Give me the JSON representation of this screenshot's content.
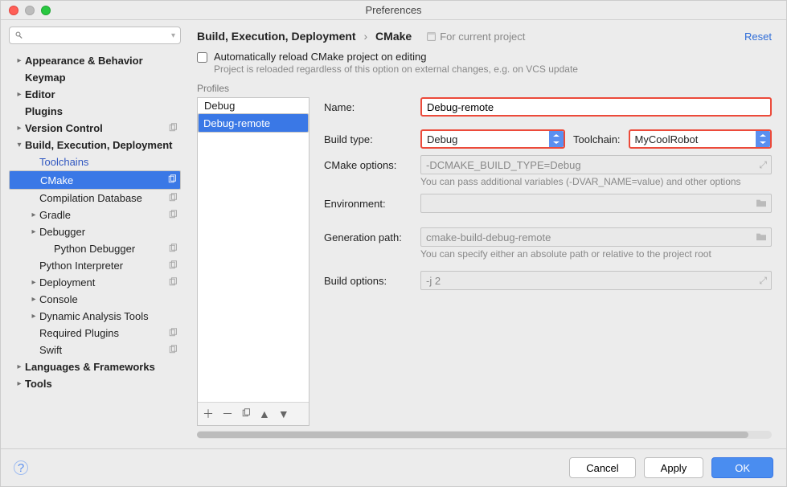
{
  "window": {
    "title": "Preferences"
  },
  "search": {
    "placeholder": ""
  },
  "sidebar": {
    "items": [
      {
        "label": "Appearance & Behavior",
        "bold": true,
        "depth": 1,
        "arrow": "▸"
      },
      {
        "label": "Keymap",
        "bold": true,
        "depth": 1
      },
      {
        "label": "Editor",
        "bold": true,
        "depth": 1,
        "arrow": "▸"
      },
      {
        "label": "Plugins",
        "bold": true,
        "depth": 1
      },
      {
        "label": "Version Control",
        "bold": true,
        "depth": 1,
        "arrow": "▸",
        "copy": true
      },
      {
        "label": "Build, Execution, Deployment",
        "bold": true,
        "depth": 1,
        "arrow": "▾"
      },
      {
        "label": "Toolchains",
        "depth": 2,
        "blue": true
      },
      {
        "label": "CMake",
        "depth": 2,
        "selected": true,
        "copy": true
      },
      {
        "label": "Compilation Database",
        "depth": 2,
        "copy": true
      },
      {
        "label": "Gradle",
        "depth": 2,
        "arrow": "▸",
        "copy": true
      },
      {
        "label": "Debugger",
        "depth": 2,
        "arrow": "▸"
      },
      {
        "label": "Python Debugger",
        "depth": 3,
        "copy": true
      },
      {
        "label": "Python Interpreter",
        "depth": 2,
        "copy": true
      },
      {
        "label": "Deployment",
        "depth": 2,
        "arrow": "▸",
        "copy": true
      },
      {
        "label": "Console",
        "depth": 2,
        "arrow": "▸"
      },
      {
        "label": "Dynamic Analysis Tools",
        "depth": 2,
        "arrow": "▸"
      },
      {
        "label": "Required Plugins",
        "depth": 2,
        "copy": true
      },
      {
        "label": "Swift",
        "depth": 2,
        "copy": true
      },
      {
        "label": "Languages & Frameworks",
        "bold": true,
        "depth": 1,
        "arrow": "▸"
      },
      {
        "label": "Tools",
        "bold": true,
        "depth": 1,
        "arrow": "▸"
      }
    ]
  },
  "breadcrumb": {
    "root": "Build, Execution, Deployment",
    "leaf": "CMake"
  },
  "for_project": "For current project",
  "reset": "Reset",
  "auto": {
    "label": "Automatically reload CMake project on editing",
    "hint": "Project is reloaded regardless of this option on external changes, e.g. on VCS update"
  },
  "profiles": {
    "label": "Profiles",
    "items": [
      {
        "name": "Debug"
      },
      {
        "name": "Debug-remote",
        "selected": true
      }
    ]
  },
  "form": {
    "name": {
      "label": "Name:",
      "value": "Debug-remote"
    },
    "build_type": {
      "label": "Build type:",
      "value": "Debug"
    },
    "toolchain": {
      "label": "Toolchain:",
      "value": "MyCoolRobot"
    },
    "cmake_options": {
      "label": "CMake options:",
      "value": "-DCMAKE_BUILD_TYPE=Debug",
      "hint": "You can pass additional variables (-DVAR_NAME=value) and other options"
    },
    "environment": {
      "label": "Environment:",
      "value": ""
    },
    "gen_path": {
      "label": "Generation path:",
      "value": "cmake-build-debug-remote",
      "hint": "You can specify either an absolute path or relative to the project root"
    },
    "build_options": {
      "label": "Build options:",
      "value": "-j 2"
    }
  },
  "footer": {
    "cancel": "Cancel",
    "apply": "Apply",
    "ok": "OK"
  }
}
